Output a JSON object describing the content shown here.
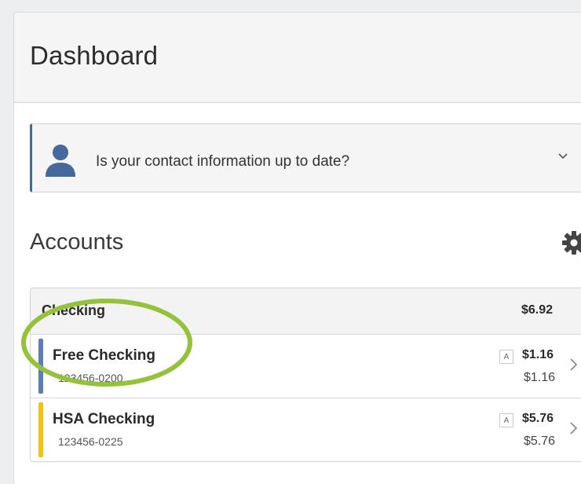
{
  "page": {
    "title": "Dashboard"
  },
  "alert": {
    "text": "Is your contact information up to date?",
    "icon": "user-icon",
    "accent_color": "#45699b"
  },
  "accounts": {
    "title": "Accounts",
    "settings_icon": "gear-icon",
    "groups": [
      {
        "name": "Checking",
        "total": "$6.92",
        "items": [
          {
            "name": "Free Checking",
            "number": "123456-0200",
            "badge": "A",
            "balance": "$1.16",
            "available": "$1.16",
            "color": "#5a7fb0"
          },
          {
            "name": "HSA Checking",
            "number": "123456-0225",
            "badge": "A",
            "balance": "$5.76",
            "available": "$5.76",
            "color": "#f5c211"
          }
        ]
      }
    ]
  },
  "annotation": {
    "highlight_color": "#95c23d"
  }
}
